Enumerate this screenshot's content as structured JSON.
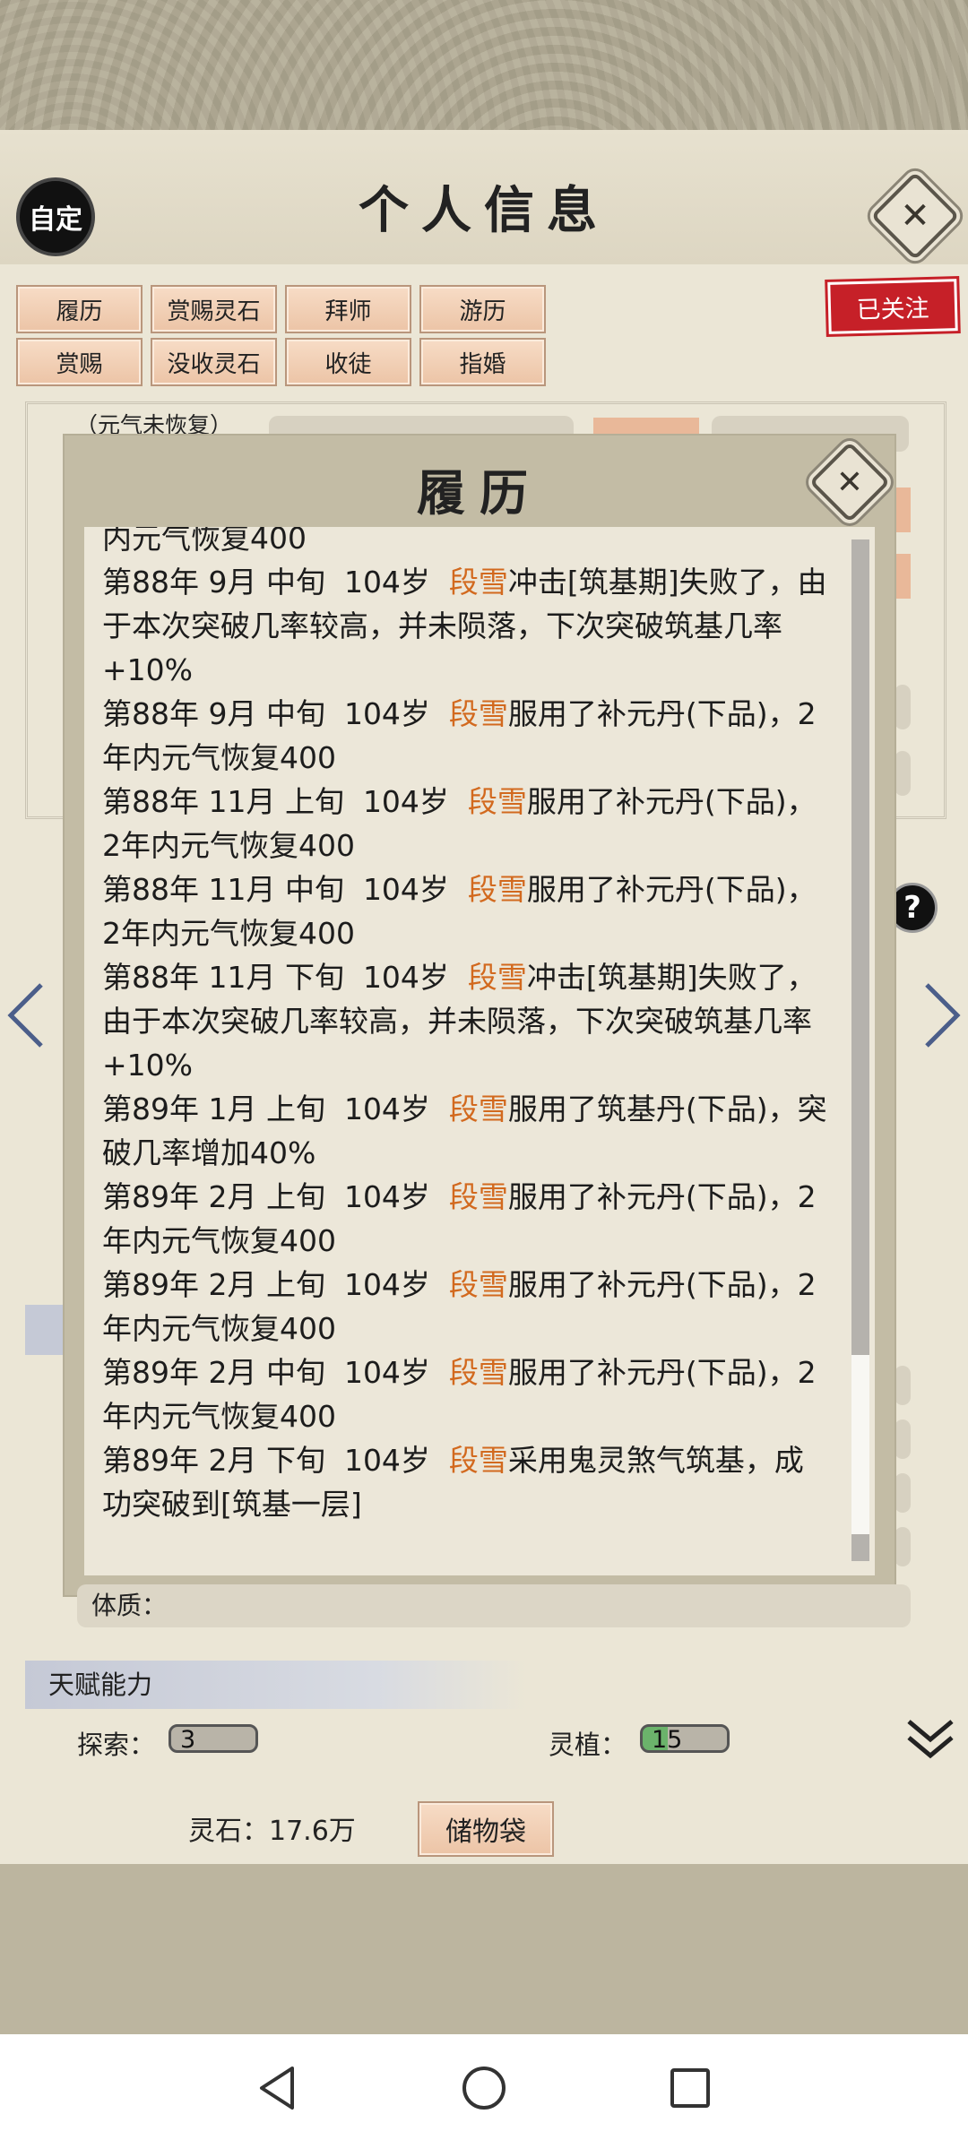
{
  "header": {
    "avatar_label": "自定",
    "title": "个人信息",
    "close_glyph": "✕"
  },
  "actions": {
    "row1": [
      "履历",
      "赏赐灵石",
      "拜师",
      "游历"
    ],
    "row2": [
      "赏赐",
      "没收灵石",
      "收徒",
      "指婚"
    ],
    "follow_label": "已关注"
  },
  "status_tag": "（元气未恢复）",
  "modal": {
    "title": "履历",
    "close_glyph": "✕",
    "entries": [
      {
        "pre": "内元气恢复400",
        "name": "",
        "post": ""
      },
      {
        "pre": "第88年 9月 中旬  104岁  ",
        "name": "段雪",
        "post": "冲击[筑基期]失败了，由于本次突破几率较高，并未陨落，下次突破筑基几率+10%"
      },
      {
        "pre": "第88年 9月 中旬  104岁  ",
        "name": "段雪",
        "post": "服用了补元丹(下品)，2年内元气恢复400"
      },
      {
        "pre": "第88年 11月 上旬  104岁  ",
        "name": "段雪",
        "post": "服用了补元丹(下品)，2年内元气恢复400"
      },
      {
        "pre": "第88年 11月 中旬  104岁  ",
        "name": "段雪",
        "post": "服用了补元丹(下品)，2年内元气恢复400"
      },
      {
        "pre": "第88年 11月 下旬  104岁  ",
        "name": "段雪",
        "post": "冲击[筑基期]失败了，由于本次突破几率较高，并未陨落，下次突破筑基几率+10%"
      },
      {
        "pre": "第89年 1月 上旬  104岁  ",
        "name": "段雪",
        "post": "服用了筑基丹(下品)，突破几率增加40%"
      },
      {
        "pre": "第89年 2月 上旬  104岁  ",
        "name": "段雪",
        "post": "服用了补元丹(下品)，2年内元气恢复400"
      },
      {
        "pre": "第89年 2月 上旬  104岁  ",
        "name": "段雪",
        "post": "服用了补元丹(下品)，2年内元气恢复400"
      },
      {
        "pre": "第89年 2月 中旬  104岁  ",
        "name": "段雪",
        "post": "服用了补元丹(下品)，2年内元气恢复400"
      },
      {
        "pre": "第89年 2月 下旬  104岁  ",
        "name": "段雪",
        "post": "采用鬼灵煞气筑基，成功突破到[筑基一层]"
      }
    ]
  },
  "body_field": {
    "label": "体质："
  },
  "talents": {
    "header": "天赋能力",
    "stats": [
      {
        "label": "探索：",
        "value": "3",
        "color": "#b9b4a8"
      },
      {
        "label": "灵植：",
        "value": "15",
        "color": "#6bb36b"
      }
    ]
  },
  "footer": {
    "stones": "灵石：17.6万",
    "bag_label": "储物袋"
  },
  "colors": {
    "accent_name": "#d2691e",
    "follow_red": "#c62028",
    "button_peach": "#ecc4a6"
  },
  "icons": [
    "back-triangle-icon",
    "home-circle-icon",
    "recents-square-icon",
    "left-arrow-icon",
    "right-arrow-icon",
    "help-icon",
    "double-chevron-down-icon",
    "close-icon"
  ]
}
